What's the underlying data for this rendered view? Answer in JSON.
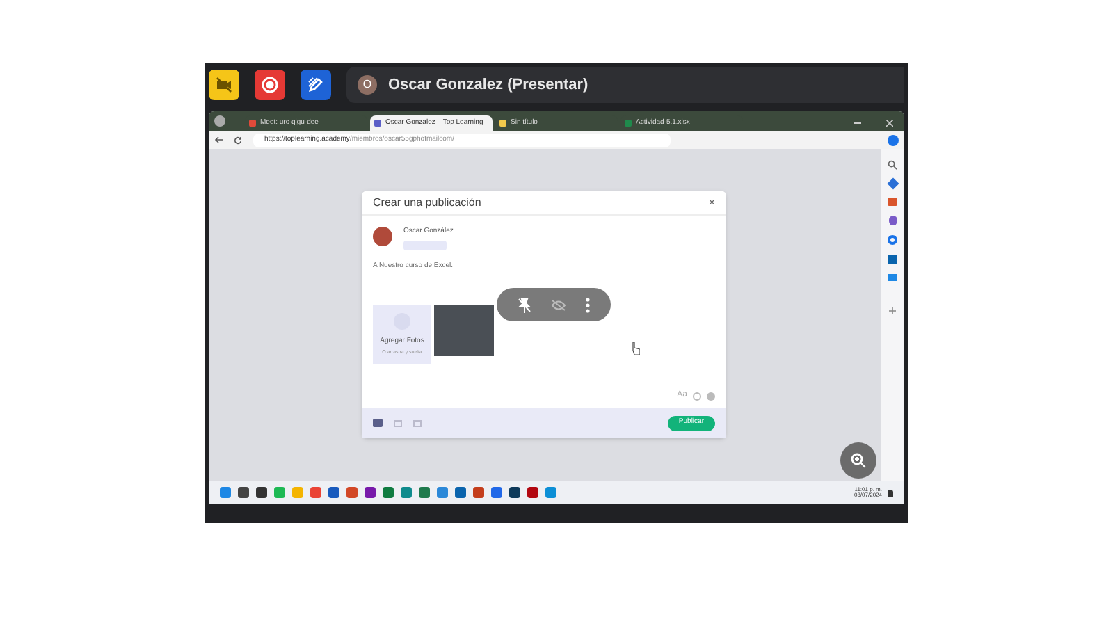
{
  "meeting_bar": {
    "presenter_initial": "O",
    "presenter": "Oscar Gonzalez (Presentar)"
  },
  "browser": {
    "tabs": [
      {
        "label": "Meet: urc-qjgu-dee",
        "selected": false,
        "color": "#e04a3a"
      },
      {
        "label": "Oscar Gonzalez – Top Learning",
        "selected": true,
        "color": "#5b5fc7"
      },
      {
        "label": "Sin título",
        "selected": false,
        "color": "#f2c94c"
      },
      {
        "label": "Actividad-5.1.xlsx",
        "selected": false,
        "color": "#1f8a4c"
      }
    ],
    "url_host": "https://toplearning.academy",
    "url_path": "/miembros/oscar55gphotmailcom/"
  },
  "dialog": {
    "title": "Crear una publicación",
    "close": "×",
    "author": "Oscar González",
    "text": "A Nuestro curso de Excel.",
    "add_photos": "Agregar Fotos",
    "add_photos_hint": "O arrastra y suelta",
    "font_toggle": "Aa",
    "publish": "Publicar"
  },
  "taskbar": {
    "apps": [
      {
        "color": "#1e88e5"
      },
      {
        "color": "#444444"
      },
      {
        "color": "#333333"
      },
      {
        "color": "#1db954"
      },
      {
        "color": "#f4b400"
      },
      {
        "color": "#ea4335"
      },
      {
        "color": "#185abd"
      },
      {
        "color": "#d24726"
      },
      {
        "color": "#7719aa"
      },
      {
        "color": "#107c41"
      },
      {
        "color": "#0f8b8d"
      },
      {
        "color": "#1f7a4d"
      },
      {
        "color": "#2b88d8"
      },
      {
        "color": "#0a64ad"
      },
      {
        "color": "#c43e1c"
      },
      {
        "color": "#2168e8"
      },
      {
        "color": "#0e3a5a"
      },
      {
        "color": "#b20710"
      },
      {
        "color": "#0c8fd6"
      }
    ],
    "time": "11:01 p. m.",
    "date": "08/07/2024"
  }
}
